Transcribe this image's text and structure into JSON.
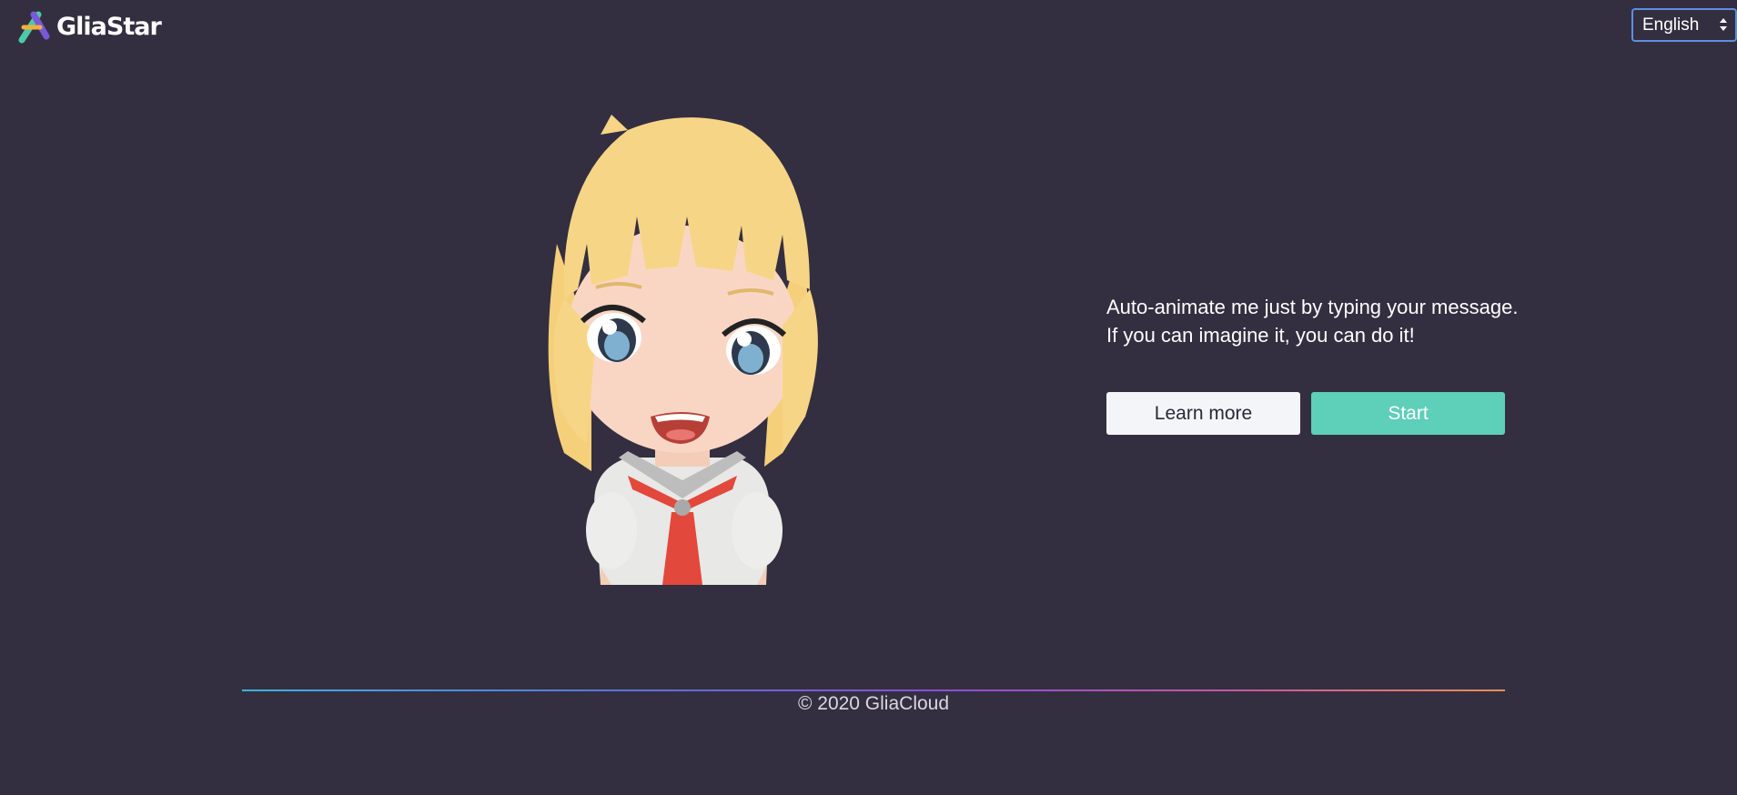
{
  "header": {
    "brand_name": "GliaStar",
    "logo_icon": "gliastar-logo-icon",
    "language_select": {
      "selected": "English"
    }
  },
  "hero": {
    "tagline_line1": "Auto-animate me just by typing your message.",
    "tagline_line2": "If you can imagine it, you can do it!",
    "learn_more_label": "Learn more",
    "start_label": "Start"
  },
  "footer": {
    "copyright": "© 2020 GliaCloud"
  },
  "colors": {
    "background": "#332f40",
    "start_button": "#5ecfb9",
    "learn_button": "#f4f5f8",
    "select_border": "#5e8fe0"
  }
}
